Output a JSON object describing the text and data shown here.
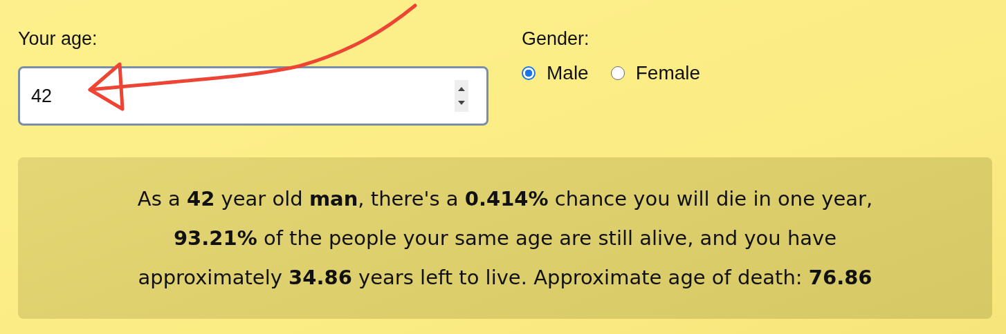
{
  "age_field": {
    "label": "Your age:",
    "value": "42"
  },
  "gender": {
    "label": "Gender:",
    "options": [
      {
        "label": "Male",
        "selected": true
      },
      {
        "label": "Female",
        "selected": false
      }
    ]
  },
  "result": {
    "text": "As a **42** year old **man**, there's a **0.414%** chance you will die in one year, **93.21%** of the people your same age are still alive, and you have approximately **34.86** years left to live. Approximate age of death: **76.86**"
  }
}
